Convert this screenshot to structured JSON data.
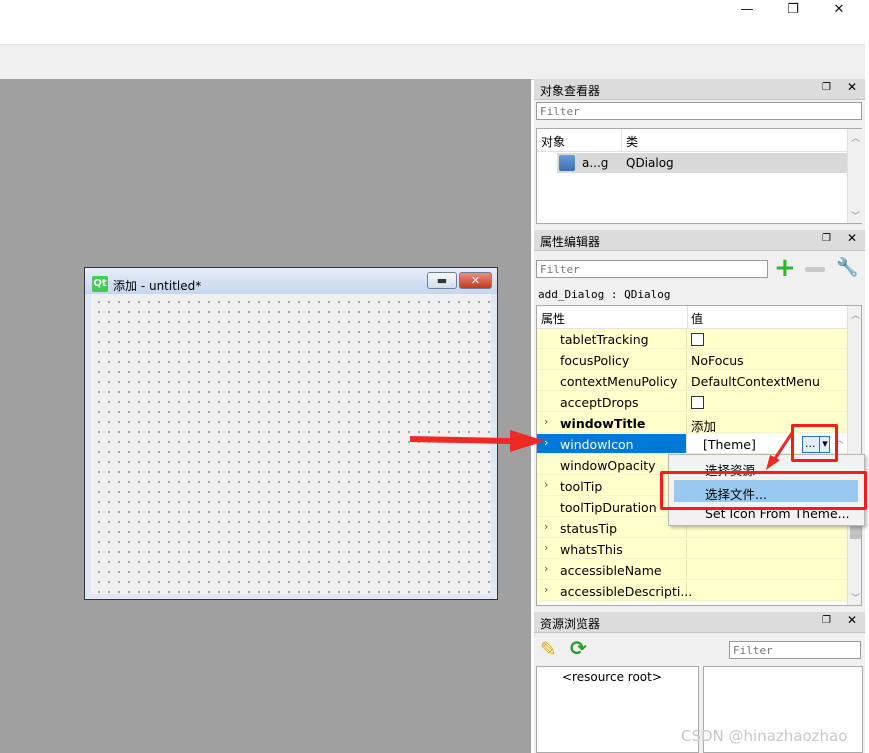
{
  "window": {
    "minimize": "—",
    "restore": "❐",
    "close": "✕"
  },
  "form": {
    "icon_text": "Qt",
    "title": "添加 - untitled*",
    "min_glyph": "▬",
    "close_glyph": "✕"
  },
  "object_inspector": {
    "title": "对象查看器",
    "filter_placeholder": "Filter",
    "col_object": "对象",
    "col_class": "类",
    "row_object": "a...g",
    "row_class": "QDialog"
  },
  "property_editor": {
    "title": "属性编辑器",
    "filter_placeholder": "Filter",
    "class_line": "add_Dialog : QDialog",
    "col_property": "属性",
    "col_value": "值",
    "rows": [
      {
        "name": "tabletTracking",
        "value": "",
        "checkbox": true,
        "expandable": false,
        "bold": false
      },
      {
        "name": "focusPolicy",
        "value": "NoFocus",
        "checkbox": false,
        "expandable": false,
        "bold": false
      },
      {
        "name": "contextMenuPolicy",
        "value": "DefaultContextMenu",
        "checkbox": false,
        "expandable": false,
        "bold": false
      },
      {
        "name": "acceptDrops",
        "value": "",
        "checkbox": true,
        "expandable": false,
        "bold": false
      },
      {
        "name": "windowTitle",
        "value": "添加",
        "checkbox": false,
        "expandable": true,
        "bold": true
      },
      {
        "name": "windowIcon",
        "value": "[Theme]",
        "checkbox": false,
        "expandable": true,
        "bold": false,
        "selected": true
      },
      {
        "name": "windowOpacity",
        "value": "",
        "checkbox": false,
        "expandable": false,
        "bold": false
      },
      {
        "name": "toolTip",
        "value": "",
        "checkbox": false,
        "expandable": true,
        "bold": false
      },
      {
        "name": "toolTipDuration",
        "value": "",
        "checkbox": false,
        "expandable": false,
        "bold": false
      },
      {
        "name": "statusTip",
        "value": "",
        "checkbox": false,
        "expandable": true,
        "bold": false
      },
      {
        "name": "whatsThis",
        "value": "",
        "checkbox": false,
        "expandable": true,
        "bold": false
      },
      {
        "name": "accessibleName",
        "value": "",
        "checkbox": false,
        "expandable": true,
        "bold": false
      },
      {
        "name": "accessibleDescripti...",
        "value": "",
        "checkbox": false,
        "expandable": true,
        "bold": false
      }
    ],
    "browse_button": "...",
    "dropdown_glyph": "▾"
  },
  "popup_menu": {
    "items": [
      "选择资源",
      "选择文件...",
      "Set Icon From Theme..."
    ],
    "highlighted_index": 1
  },
  "resource_browser": {
    "title": "资源浏览器",
    "filter_placeholder": "Filter",
    "root": "<resource root>"
  },
  "watermark": "CSDN @hinazhaozhao",
  "colors": {
    "selection": "#0078d7",
    "annotation_red": "#ff1a1a",
    "property_row_bg": "#ffffcc",
    "menu_highlight": "#99c9ef"
  }
}
